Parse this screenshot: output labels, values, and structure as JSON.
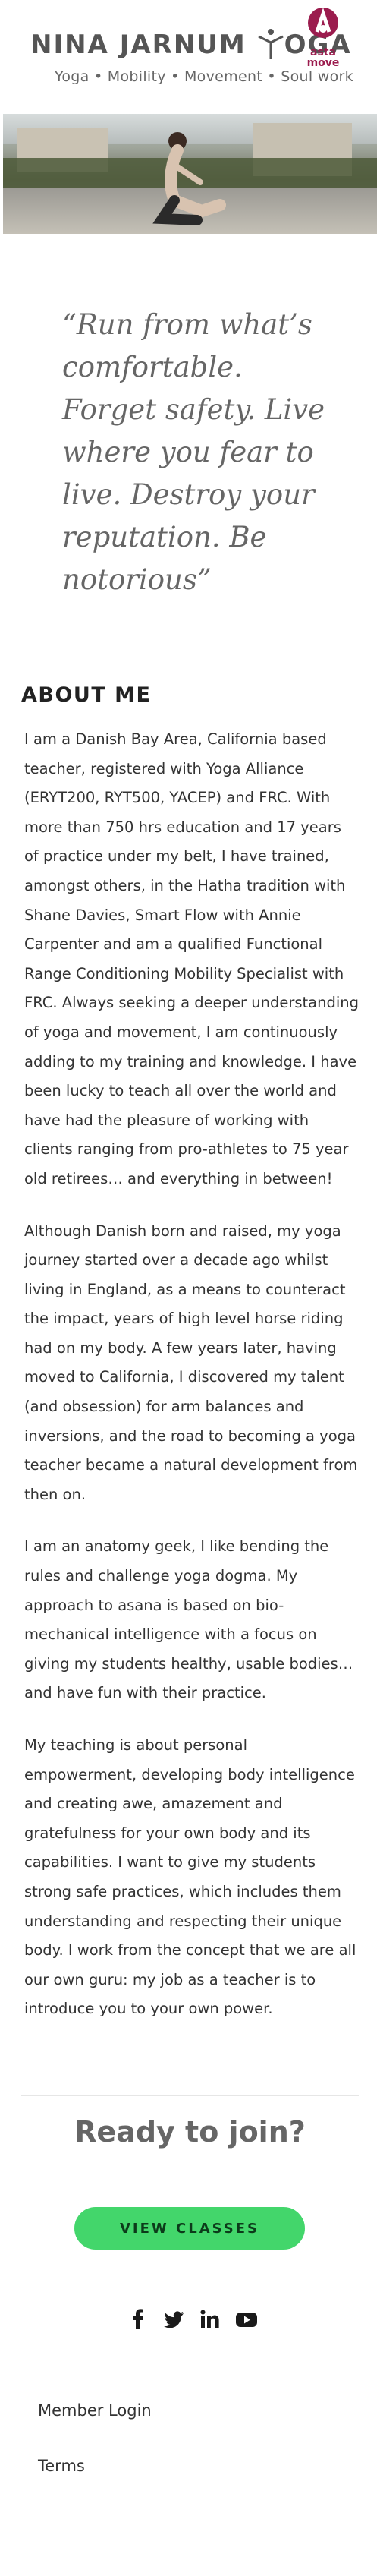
{
  "header": {
    "brand_left": "NINA JARNUM",
    "brand_right": "OGA",
    "tagline": "Yoga • Mobility • Movement • Soul work",
    "partner_logo_text_line1": "asta",
    "partner_logo_text_line2": "move",
    "partner_logo_color": "#9b1c4e"
  },
  "hero": {
    "image_description_icon": "yoga-pose-photo"
  },
  "quote": "“Run from what’s comfortable. Forget safety. Live where you fear to live. Destroy your reputation. Be notorious”",
  "about": {
    "title": "ABOUT ME",
    "paragraphs": [
      "I am a Danish Bay Area, California based teacher, registered with Yoga Alliance (ERYT200, RYT500, YACEP) and FRC. With more than 750 hrs education and 17 years of practice under my belt, I have trained, amongst others, in the Hatha tradition with Shane Davies, Smart Flow with Annie Carpenter and am a qualified Functional Range Conditioning Mobility Specialist with FRC. Always seeking a deeper understanding of yoga and movement, I am continuously adding to my training and knowledge. I have been lucky to teach all over the world and have had the pleasure of working with clients ranging from pro-athletes to 75 year old retirees… and everything in between!",
      "Although Danish born and raised, my yoga journey started over a decade ago whilst living in England, as a means to counteract the impact,  years of high level horse riding had on my body. A few years later, having moved to California,  I discovered my  talent (and obsession) for arm balances and inversions, and the road to becoming a yoga teacher became a natural development from then on.",
      "I am an anatomy geek, I like bending the rules and challenge yoga dogma. My approach to asana is based  on bio-mechanical intelligence with a focus on giving my students healthy, usable bodies… and have fun with their practice.",
      "My teaching is about personal empowerment, developing body intelligence and creating awe, amazement and gratefulness for your own body and its capabilities.  I want to give my students strong safe practices, which includes  them understanding and respecting their unique body. I work from the concept that we are all our own guru: my job as a teacher is to introduce you to your own power."
    ]
  },
  "cta": {
    "heading": "Ready to join?",
    "button_label": "VIEW CLASSES",
    "button_color": "#43d66b"
  },
  "social": [
    "facebook-icon",
    "twitter-icon",
    "linkedin-icon",
    "youtube-icon"
  ],
  "footer": {
    "member_login": "Member Login",
    "terms": "Terms"
  }
}
